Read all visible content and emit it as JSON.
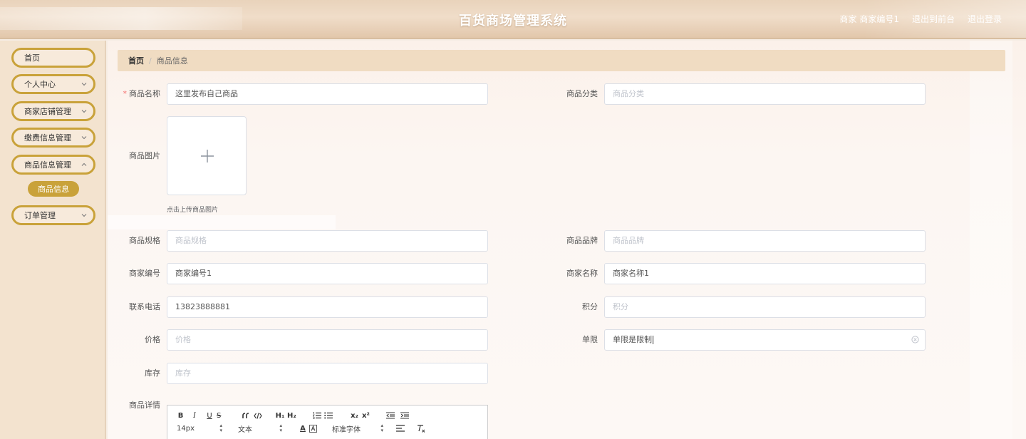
{
  "app": {
    "title": "百货商场管理系统"
  },
  "header": {
    "role": "商家",
    "username": "商家编号1",
    "front_link": "退出到前台",
    "logout_link": "退出登录"
  },
  "sidebar": {
    "items": [
      {
        "label": "首页"
      },
      {
        "label": "个人中心"
      },
      {
        "label": "商家店铺管理"
      },
      {
        "label": "缴费信息管理"
      },
      {
        "label": "商品信息管理"
      },
      {
        "label": "订单管理"
      }
    ],
    "active_sub": "商品信息"
  },
  "breadcrumb": {
    "home": "首页",
    "separator": "/",
    "current": "商品信息"
  },
  "form": {
    "name": {
      "label": "商品名称",
      "value": "这里发布自己商品",
      "required": true
    },
    "category": {
      "label": "商品分类",
      "placeholder": "商品分类"
    },
    "image": {
      "label": "商品图片",
      "tip": "点击上传商品图片"
    },
    "spec": {
      "label": "商品规格",
      "placeholder": "商品规格"
    },
    "brand": {
      "label": "商品品牌",
      "placeholder": "商品品牌"
    },
    "merchant_no": {
      "label": "商家编号",
      "value": "商家编号1"
    },
    "merchant_name": {
      "label": "商家名称",
      "value": "商家名称1"
    },
    "phone": {
      "label": "联系电话",
      "value": "13823888881"
    },
    "points": {
      "label": "积分",
      "placeholder": "积分"
    },
    "price": {
      "label": "价格",
      "placeholder": "价格"
    },
    "limit": {
      "label": "单限",
      "value": "单限是限制"
    },
    "stock": {
      "label": "库存",
      "placeholder": "库存"
    },
    "detail": {
      "label": "商品详情"
    }
  },
  "editor": {
    "font_size": "14px",
    "block_type": "文本",
    "font_family": "标准字体",
    "buttons": {
      "bold": "B",
      "italic": "I",
      "underline": "U",
      "strike": "S",
      "h1": "H₁",
      "h2": "H₂",
      "sub": "x₂",
      "sup": "x²",
      "color": "A"
    }
  },
  "colors": {
    "accent": "#c9a23a",
    "sidebar_bg": "#f3e3cf",
    "breadcrumb_bg": "#f0dcc2",
    "required": "#f56c6c"
  }
}
